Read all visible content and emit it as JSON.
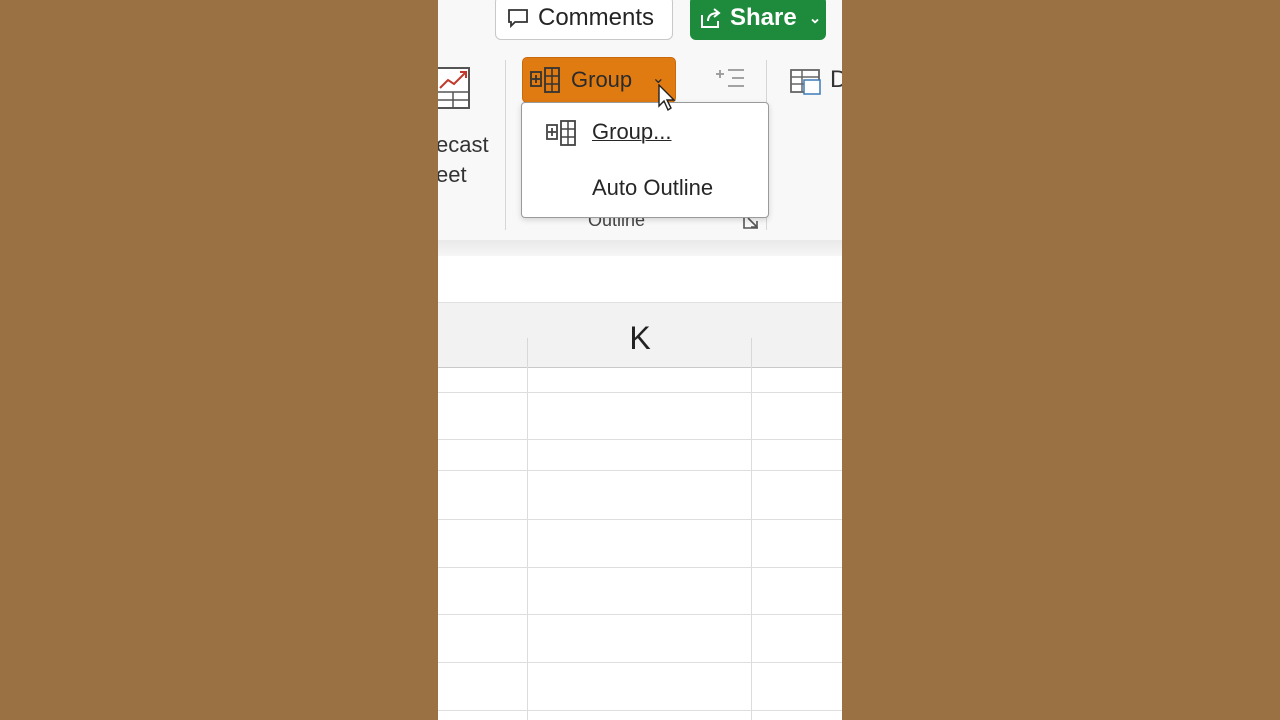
{
  "header": {
    "comments_label": "Comments",
    "share_label": "Share"
  },
  "ribbon": {
    "forecast_label_line1": "ecast",
    "forecast_label_line2": "eet",
    "group_button_label": "Group",
    "data_label": "D",
    "outline_group_label": "Outline"
  },
  "dropdown": {
    "items": [
      {
        "label": "Group...",
        "icon": "group-icon"
      },
      {
        "label": "Auto Outline",
        "icon": ""
      }
    ]
  },
  "sheet": {
    "column_header": "K"
  },
  "colors": {
    "background": "#9a7142",
    "group_button_highlight": "#e07b12",
    "share_button": "#1e8a3c"
  }
}
